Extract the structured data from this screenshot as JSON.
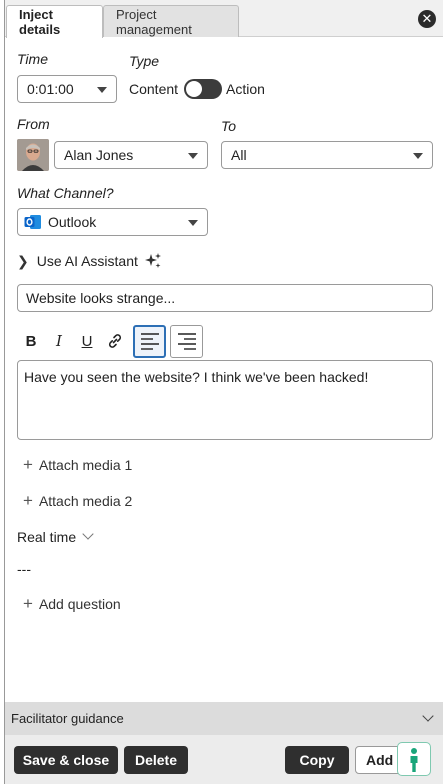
{
  "tabs": [
    {
      "label": "Inject details",
      "active": true
    },
    {
      "label": "Project management",
      "active": false
    }
  ],
  "close_icon": "close-icon",
  "time": {
    "label": "Time",
    "value": "0:01:00"
  },
  "type": {
    "label": "Type",
    "left_label": "Content",
    "right_label": "Action",
    "state": "Content"
  },
  "from": {
    "label": "From",
    "value": "Alan Jones",
    "avatar_icon": "user-avatar"
  },
  "to": {
    "label": "To",
    "value": "All"
  },
  "channel": {
    "label": "What Channel?",
    "value": "Outlook",
    "icon": "outlook-icon"
  },
  "ai_assistant": {
    "label": "Use AI Assistant",
    "icon": "sparkles-icon"
  },
  "subject": {
    "value": "Website looks strange..."
  },
  "toolbar": {
    "bold": "B",
    "italic": "I",
    "underline": "U",
    "link_icon": "link-icon",
    "align_left_icon": "align-left-icon",
    "align_right_icon": "align-right-icon"
  },
  "body": {
    "value": "Have you seen the website? I think we've been hacked!"
  },
  "attach_media_1": "Attach media 1",
  "attach_media_2": "Attach media 2",
  "real_time": {
    "label": "Real time"
  },
  "separator_text": "---",
  "add_question": "Add question",
  "guidance": {
    "label": "Facilitator guidance"
  },
  "footer": {
    "save_close": "Save & close",
    "delete": "Delete",
    "copy": "Copy",
    "add_more": "Add m"
  },
  "colors": {
    "accent": "#2d6fb5",
    "dark_button": "#2f2f2f",
    "outlook_blue": "#0a64c9"
  }
}
